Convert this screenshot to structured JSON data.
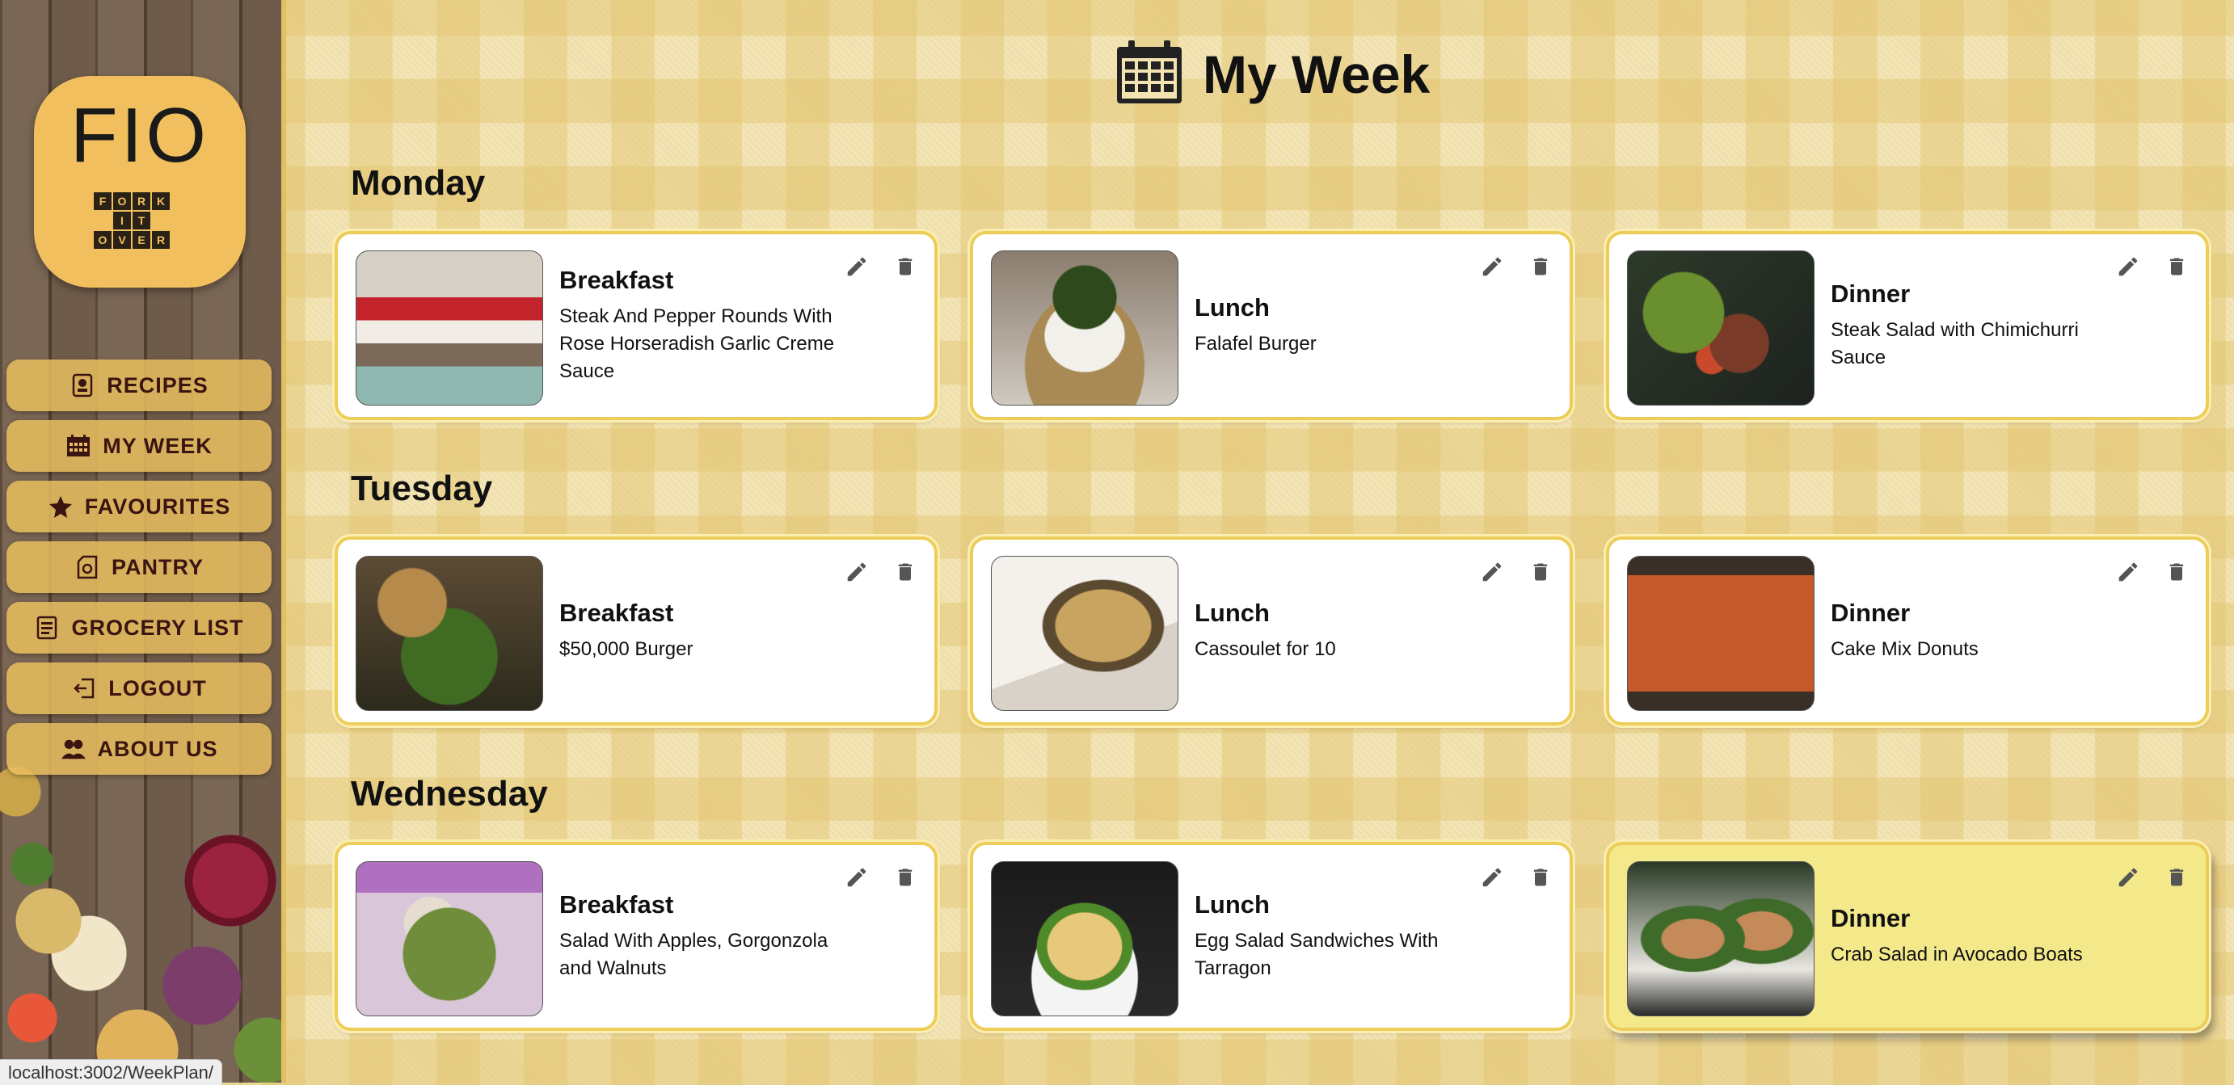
{
  "browser": {
    "status_url": "localhost:3002/WeekPlan/"
  },
  "brand": {
    "logo_text": "FIO",
    "logo_grid": [
      "F",
      "O",
      "R",
      "K",
      "",
      "",
      "I",
      "T",
      "",
      "",
      "O",
      "V",
      "E",
      "R",
      ""
    ]
  },
  "nav": {
    "items": [
      {
        "label": "RECIPES",
        "icon": "chef-card-icon"
      },
      {
        "label": "MY WEEK",
        "icon": "calendar-icon"
      },
      {
        "label": "FAVOURITES",
        "icon": "star-icon"
      },
      {
        "label": "PANTRY",
        "icon": "pantry-icon"
      },
      {
        "label": "GROCERY LIST",
        "icon": "list-icon"
      },
      {
        "label": "LOGOUT",
        "icon": "logout-icon"
      },
      {
        "label": "ABOUT US",
        "icon": "people-icon"
      }
    ]
  },
  "header": {
    "title": "My Week",
    "icon": "calendar-icon"
  },
  "days": [
    {
      "name": "Monday",
      "meals": [
        {
          "type": "Breakfast",
          "name": "Steak And Pepper Rounds With Rose Horseradish Garlic Creme Sauce"
        },
        {
          "type": "Lunch",
          "name": "Falafel Burger"
        },
        {
          "type": "Dinner",
          "name": "Steak Salad with Chimichurri Sauce"
        }
      ]
    },
    {
      "name": "Tuesday",
      "meals": [
        {
          "type": "Breakfast",
          "name": "$50,000 Burger"
        },
        {
          "type": "Lunch",
          "name": "Cassoulet for 10"
        },
        {
          "type": "Dinner",
          "name": "Cake Mix Donuts"
        }
      ]
    },
    {
      "name": "Wednesday",
      "meals": [
        {
          "type": "Breakfast",
          "name": "Salad With Apples, Gorgonzola and Walnuts"
        },
        {
          "type": "Lunch",
          "name": "Egg Salad Sandwiches With Tarragon"
        },
        {
          "type": "Dinner",
          "name": "Crab Salad in Avocado Boats",
          "hovered": true
        }
      ]
    }
  ],
  "colors": {
    "card_border": "#edcd5a",
    "card_hover": "#f3e98b",
    "nav_button": "#e9be5f",
    "nav_text": "#3a1410",
    "logo_bg": "#f1bf5d"
  }
}
